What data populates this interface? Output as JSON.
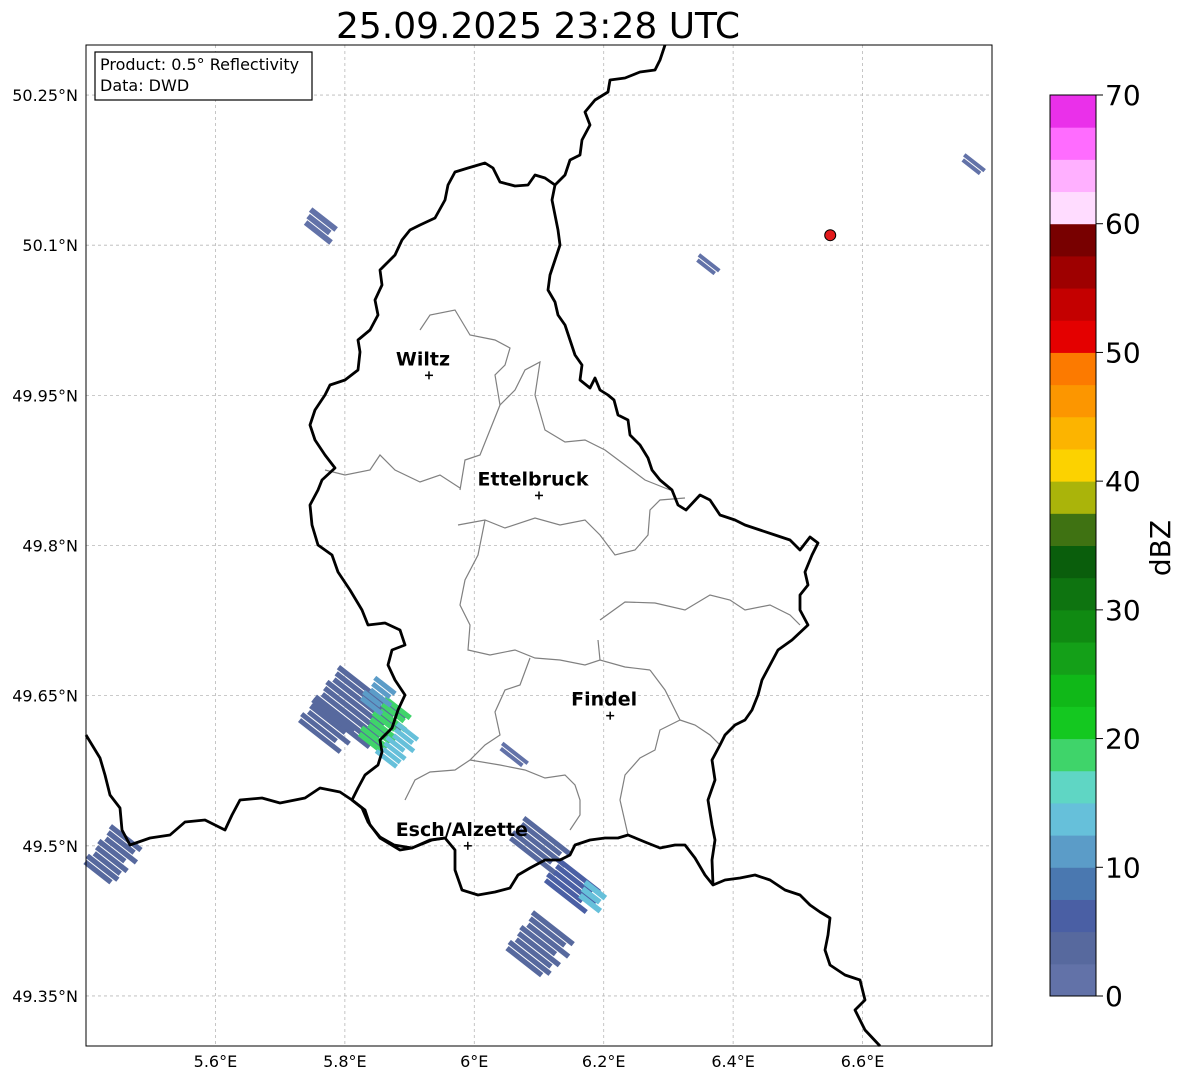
{
  "title": "25.09.2025 23:28 UTC",
  "info_box": {
    "product": "Product: 0.5° Reflectivity",
    "data": "Data: DWD"
  },
  "map": {
    "lon_range": [
      5.4,
      6.8
    ],
    "lat_range": [
      49.3,
      50.3
    ],
    "lon_ticks": [
      {
        "value": 5.6,
        "label": "5.6°E"
      },
      {
        "value": 5.8,
        "label": "5.8°E"
      },
      {
        "value": 6.0,
        "label": "6°E"
      },
      {
        "value": 6.2,
        "label": "6.2°E"
      },
      {
        "value": 6.4,
        "label": "6.4°E"
      },
      {
        "value": 6.6,
        "label": "6.6°E"
      }
    ],
    "lat_ticks": [
      {
        "value": 50.25,
        "label": "50.25°N"
      },
      {
        "value": 50.1,
        "label": "50.1°N"
      },
      {
        "value": 49.95,
        "label": "49.95°N"
      },
      {
        "value": 49.8,
        "label": "49.8°N"
      },
      {
        "value": 49.65,
        "label": "49.65°N"
      },
      {
        "value": 49.5,
        "label": "49.5°N"
      },
      {
        "value": 49.35,
        "label": "49.35°N"
      }
    ],
    "grid": true,
    "cities": [
      {
        "name": "Wiltz",
        "lon": 5.93,
        "lat": 49.97
      },
      {
        "name": "Ettelbruck",
        "lon": 6.1,
        "lat": 49.85
      },
      {
        "name": "Findel",
        "lon": 6.21,
        "lat": 49.63
      },
      {
        "name": "Esch/Alzette",
        "lon": 5.99,
        "lat": 49.5
      }
    ],
    "radar_site": {
      "lon": 6.55,
      "lat": 50.11,
      "color": "#e31a1c"
    }
  },
  "colorbar": {
    "label": "dBZ",
    "min": 0,
    "max": 70,
    "step": 2.5,
    "tick_values": [
      0,
      10,
      20,
      30,
      40,
      50,
      60,
      70
    ],
    "colors": [
      "#6272a8",
      "#57699e",
      "#4a5fa4",
      "#4a78b0",
      "#5b9cc8",
      "#66c0da",
      "#5fd6c4",
      "#3fd46a",
      "#14c820",
      "#10b818",
      "#14a018",
      "#108a12",
      "#0e7410",
      "#0a5e0c",
      "#3f7212",
      "#aab40a",
      "#fcd200",
      "#fcb400",
      "#fc9600",
      "#fc7a00",
      "#e40000",
      "#c40000",
      "#9e0000",
      "#780000",
      "#ffdcff",
      "#ffb0ff",
      "#ff6cff",
      "#ea30ea"
    ]
  },
  "echoes": [
    {
      "lon": 5.82,
      "lat": 49.635,
      "width_deg": 0.13,
      "length_deg": 0.05,
      "dbz": 4
    },
    {
      "lon": 5.77,
      "lat": 49.62,
      "width_deg": 0.08,
      "length_deg": 0.03,
      "dbz": 3
    },
    {
      "lon": 5.86,
      "lat": 49.62,
      "width_deg": 0.05,
      "length_deg": 0.05,
      "dbz": 18
    },
    {
      "lon": 5.88,
      "lat": 49.6,
      "width_deg": 0.04,
      "length_deg": 0.04,
      "dbz": 14
    },
    {
      "lon": 5.85,
      "lat": 49.65,
      "width_deg": 0.04,
      "length_deg": 0.03,
      "dbz": 12
    },
    {
      "lon": 6.1,
      "lat": 49.5,
      "width_deg": 0.09,
      "length_deg": 0.03,
      "dbz": 4
    },
    {
      "lon": 6.15,
      "lat": 49.46,
      "width_deg": 0.08,
      "length_deg": 0.03,
      "dbz": 6
    },
    {
      "lon": 6.18,
      "lat": 49.45,
      "width_deg": 0.04,
      "length_deg": 0.02,
      "dbz": 13
    },
    {
      "lon": 6.1,
      "lat": 49.4,
      "width_deg": 0.08,
      "length_deg": 0.05,
      "dbz": 3
    },
    {
      "lon": 5.44,
      "lat": 49.49,
      "width_deg": 0.06,
      "length_deg": 0.05,
      "dbz": 3
    },
    {
      "lon": 5.76,
      "lat": 50.12,
      "width_deg": 0.05,
      "length_deg": 0.02,
      "dbz": 2
    },
    {
      "lon": 6.36,
      "lat": 50.08,
      "width_deg": 0.04,
      "length_deg": 0.01,
      "dbz": 2
    },
    {
      "lon": 6.77,
      "lat": 50.18,
      "width_deg": 0.04,
      "length_deg": 0.01,
      "dbz": 2
    },
    {
      "lon": 6.06,
      "lat": 49.59,
      "width_deg": 0.05,
      "length_deg": 0.01,
      "dbz": 2
    }
  ]
}
